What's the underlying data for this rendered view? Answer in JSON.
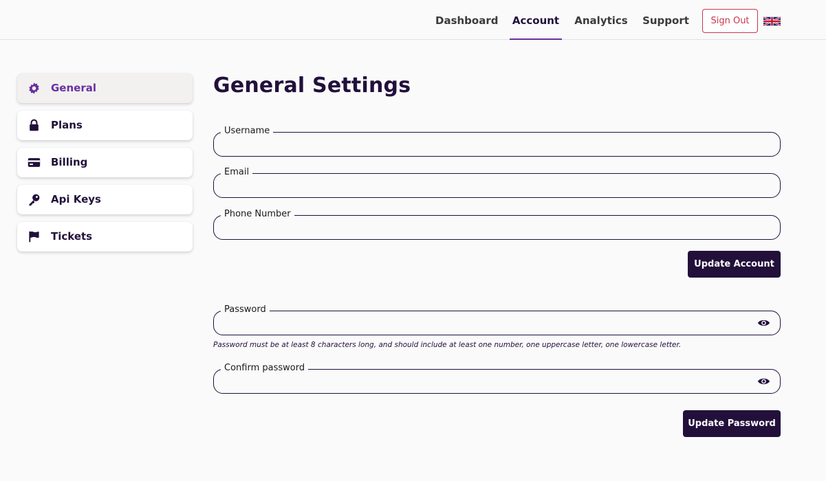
{
  "nav": {
    "items": [
      {
        "label": "Dashboard",
        "active": false
      },
      {
        "label": "Account",
        "active": true
      },
      {
        "label": "Analytics",
        "active": false
      },
      {
        "label": "Support",
        "active": false
      }
    ],
    "sign_out": "Sign Out",
    "language_icon": "uk-flag-icon",
    "accent_color": "#6a2fa0",
    "danger_color": "#c9364c"
  },
  "sidebar": {
    "items": [
      {
        "label": "General",
        "icon": "gear-icon",
        "active": true
      },
      {
        "label": "Plans",
        "icon": "lock-icon",
        "active": false
      },
      {
        "label": "Billing",
        "icon": "credit-card-icon",
        "active": false
      },
      {
        "label": "Api Keys",
        "icon": "key-icon",
        "active": false
      },
      {
        "label": "Tickets",
        "icon": "flag-icon",
        "active": false
      }
    ]
  },
  "main": {
    "title": "General Settings",
    "account_form": {
      "username": {
        "label": "Username",
        "value": ""
      },
      "email": {
        "label": "Email",
        "value": ""
      },
      "phone": {
        "label": "Phone Number",
        "value": ""
      },
      "submit": "Update Account"
    },
    "password_form": {
      "password": {
        "label": "Password",
        "value": ""
      },
      "hint": "Password must be at least 8 characters long, and should include at least one number, one uppercase letter, one lowercase letter.",
      "confirm": {
        "label": "Confirm password",
        "value": ""
      },
      "submit": "Update Password"
    },
    "primary_color": "#22103b"
  }
}
